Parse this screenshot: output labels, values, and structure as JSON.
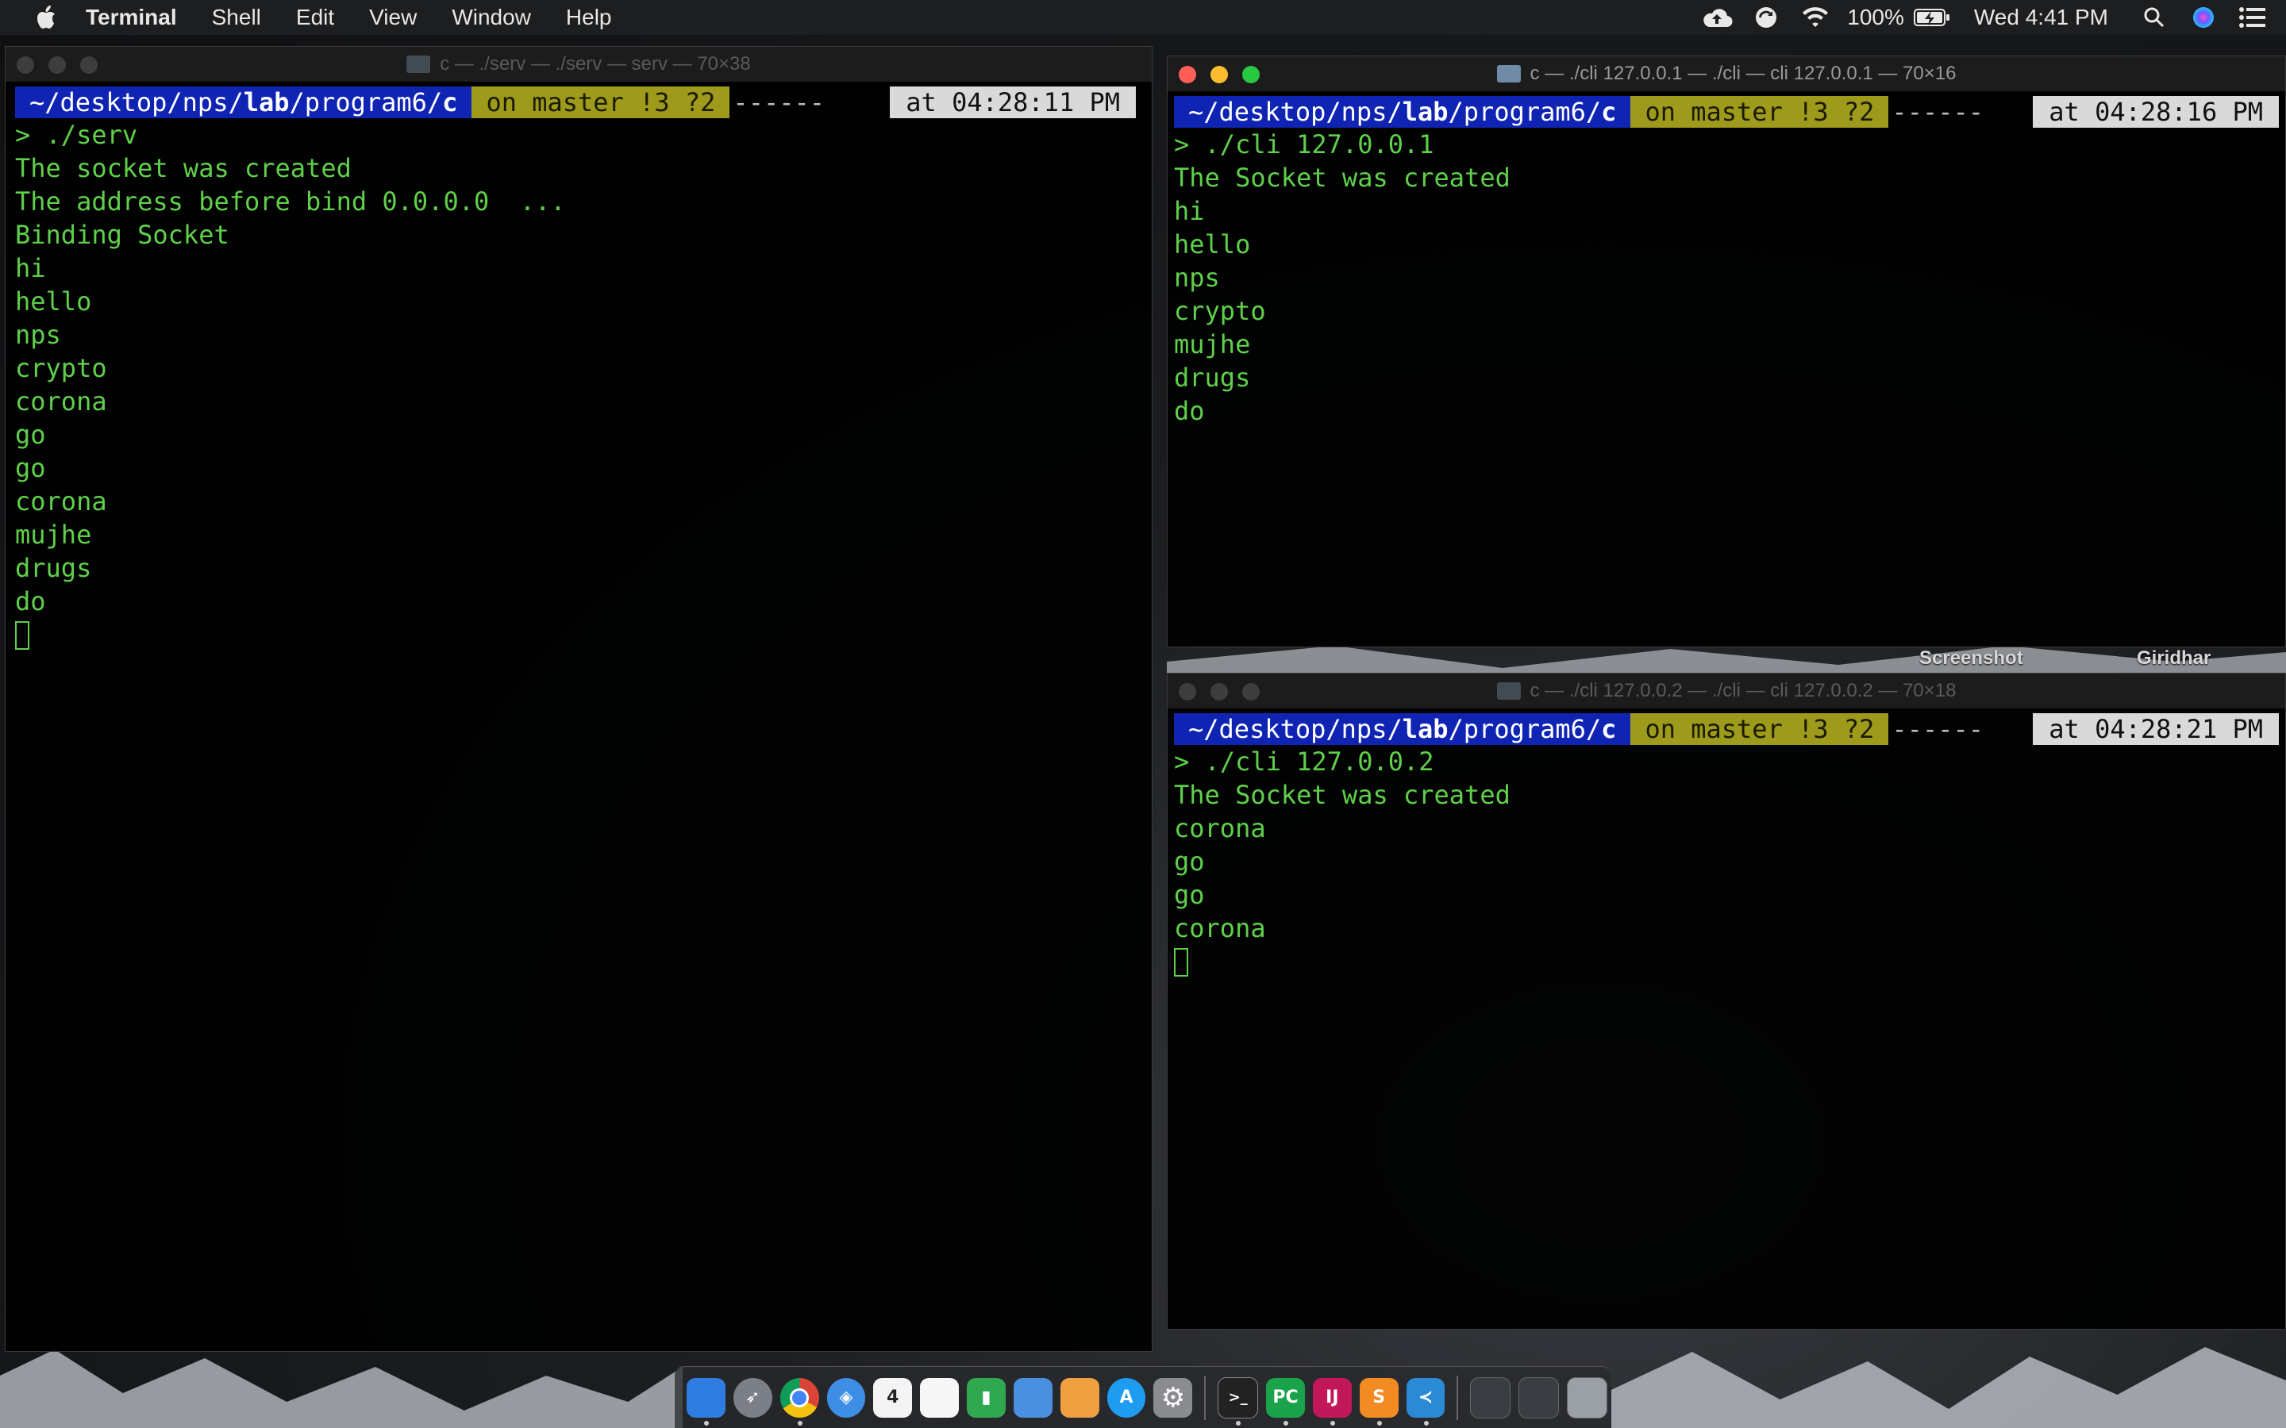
{
  "menubar": {
    "app_name": "Terminal",
    "items": [
      "Shell",
      "Edit",
      "View",
      "Window",
      "Help"
    ],
    "battery": "100%",
    "clock": "Wed 4:41 PM"
  },
  "windows": {
    "serv": {
      "title": "c — ./serv — ./serv — serv — 70×38",
      "prompt": {
        "path_prefix": "~/desktop/nps/",
        "path_bold": "lab",
        "path_mid": "/program6/",
        "path_end": "c",
        "git": "on master !3 ?2",
        "dashes": "------",
        "time": "at 04:28:11 PM"
      },
      "command": "> ./serv",
      "output": [
        "The socket was created",
        "The address before bind 0.0.0.0  ...",
        "Binding Socket",
        "hi",
        "hello",
        "nps",
        "crypto",
        "corona",
        "go",
        "go",
        "corona",
        "mujhe",
        "drugs",
        "do"
      ]
    },
    "cli1": {
      "title": "c — ./cli 127.0.0.1 — ./cli — cli 127.0.0.1 — 70×16",
      "prompt": {
        "path_prefix": "~/desktop/nps/",
        "path_bold": "lab",
        "path_mid": "/program6/",
        "path_end": "c",
        "git": "on master !3 ?2",
        "dashes": "------",
        "time": "at 04:28:16 PM"
      },
      "command": "> ./cli 127.0.0.1",
      "output": [
        "The Socket was created",
        "hi",
        "hello",
        "nps",
        "crypto",
        "mujhe",
        "drugs",
        "do"
      ]
    },
    "cli2": {
      "title": "c — ./cli 127.0.0.2 — ./cli — cli 127.0.0.2 — 70×18",
      "prompt": {
        "path_prefix": "~/desktop/nps/",
        "path_bold": "lab",
        "path_mid": "/program6/",
        "path_end": "c",
        "git": "on master !3 ?2",
        "dashes": "------",
        "time": "at 04:28:21 PM"
      },
      "command": "> ./cli 127.0.0.2",
      "output": [
        "The Socket was created",
        "corona",
        "go",
        "go",
        "corona"
      ]
    }
  },
  "desktop": {
    "labels": [
      "Screenshot",
      "Giridhar"
    ]
  },
  "dock": {
    "apps": [
      {
        "name": "Finder",
        "icon": "finder-icon",
        "color": "#2f7de1"
      },
      {
        "name": "Launchpad",
        "icon": "rocket-icon",
        "color": "#7b7f88"
      },
      {
        "name": "Chrome",
        "icon": "chrome-icon",
        "color": "#e9b53a"
      },
      {
        "name": "Safari",
        "icon": "compass-icon",
        "color": "#3e8ee6"
      },
      {
        "name": "Calendar",
        "icon": "calendar-icon",
        "color": "#f4f4f4"
      },
      {
        "name": "Reminders",
        "icon": "list-icon",
        "color": "#f7f7f7"
      },
      {
        "name": "Numbers",
        "icon": "chart-icon",
        "color": "#2fa84f"
      },
      {
        "name": "Keynote",
        "icon": "keynote-icon",
        "color": "#4a8fe0"
      },
      {
        "name": "Pages",
        "icon": "pen-icon",
        "color": "#f0a040"
      },
      {
        "name": "App Store",
        "icon": "appstore-icon",
        "color": "#1e9cf0"
      },
      {
        "name": "System Preferences",
        "icon": "gear-icon",
        "color": "#8a8c90"
      },
      {
        "name": "Terminal",
        "icon": "terminal-icon",
        "color": "#222222"
      },
      {
        "name": "PyCharm",
        "icon": "pycharm-icon",
        "color": "#1aa34a"
      },
      {
        "name": "IntelliJ",
        "icon": "intellij-icon",
        "color": "#c2185b"
      },
      {
        "name": "Sublime Text",
        "icon": "sublime-icon",
        "color": "#f28b22"
      },
      {
        "name": "VS Code",
        "icon": "vscode-icon",
        "color": "#2b8ad6"
      }
    ],
    "calendar_day": "4",
    "pycharm_text": "PC",
    "intellij_text": "IJ"
  }
}
